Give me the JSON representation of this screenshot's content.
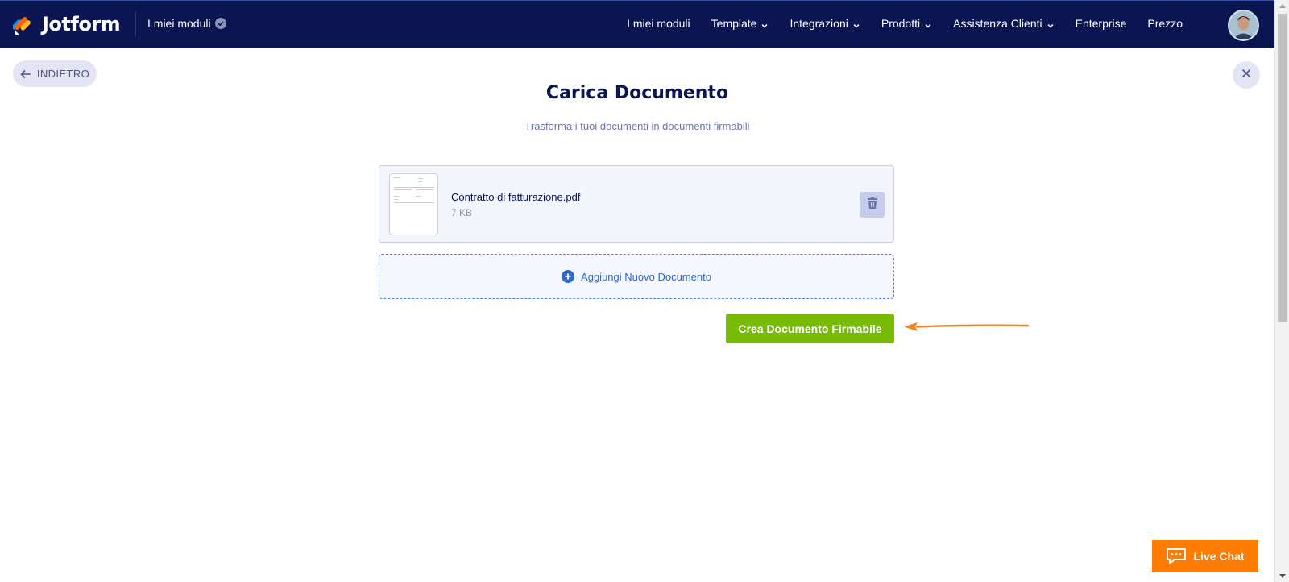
{
  "header": {
    "brand_name": "Jotform",
    "my_forms_label": "I miei moduli",
    "nav": [
      {
        "label": "I miei moduli",
        "has_dropdown": false
      },
      {
        "label": "Template",
        "has_dropdown": true
      },
      {
        "label": "Integrazioni",
        "has_dropdown": true
      },
      {
        "label": "Prodotti",
        "has_dropdown": true
      },
      {
        "label": "Assistenza Clienti",
        "has_dropdown": true
      },
      {
        "label": "Enterprise",
        "has_dropdown": false
      },
      {
        "label": "Prezzo",
        "has_dropdown": false
      }
    ],
    "colors": {
      "background": "#0a1551"
    }
  },
  "back_button": {
    "label": "INDIETRO"
  },
  "page": {
    "title": "Carica Documento",
    "subtitle": "Trasforma i tuoi documenti in documenti firmabili"
  },
  "file": {
    "name": "Contratto di fatturazione.pdf",
    "size": "7 KB"
  },
  "add_document": {
    "label": "Aggiungi Nuovo Documento"
  },
  "create_button": {
    "label": "Crea Documento Firmabile",
    "color": "#78bb07"
  },
  "live_chat": {
    "label": "Live Chat",
    "color": "#ff7c00"
  },
  "icons": [
    "jotform-logo-icon",
    "verified-check-icon",
    "chevron-down-icon",
    "arrow-left-icon",
    "close-icon",
    "trash-icon",
    "plus-circle-icon",
    "chat-bubble-icon",
    "annotation-arrow-icon"
  ]
}
